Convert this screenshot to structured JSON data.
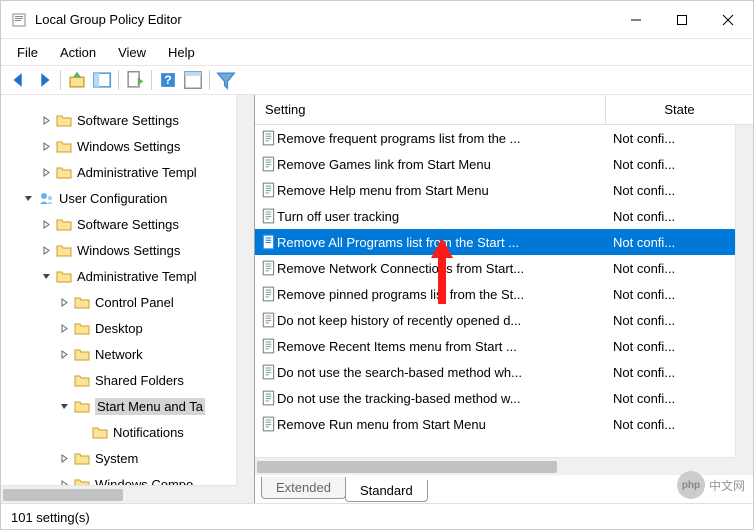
{
  "window": {
    "title": "Local Group Policy Editor"
  },
  "menu": {
    "file": "File",
    "action": "Action",
    "view": "View",
    "help": "Help"
  },
  "tree": {
    "items": [
      {
        "level": 2,
        "expand": "closed",
        "icon": "folder",
        "label": "Software Settings",
        "sel": false
      },
      {
        "level": 2,
        "expand": "closed",
        "icon": "folder",
        "label": "Windows Settings",
        "sel": false
      },
      {
        "level": 2,
        "expand": "closed",
        "icon": "folder",
        "label": "Administrative Templ",
        "sel": false
      },
      {
        "level": 1,
        "expand": "open",
        "icon": "user",
        "label": "User Configuration",
        "sel": false
      },
      {
        "level": 2,
        "expand": "closed",
        "icon": "folder",
        "label": "Software Settings",
        "sel": false
      },
      {
        "level": 2,
        "expand": "closed",
        "icon": "folder",
        "label": "Windows Settings",
        "sel": false
      },
      {
        "level": 2,
        "expand": "open",
        "icon": "folder",
        "label": "Administrative Templ",
        "sel": false
      },
      {
        "level": 3,
        "expand": "closed",
        "icon": "folder",
        "label": "Control Panel",
        "sel": false
      },
      {
        "level": 3,
        "expand": "closed",
        "icon": "folder",
        "label": "Desktop",
        "sel": false
      },
      {
        "level": 3,
        "expand": "closed",
        "icon": "folder",
        "label": "Network",
        "sel": false
      },
      {
        "level": 3,
        "expand": "none",
        "icon": "folder",
        "label": "Shared Folders",
        "sel": false
      },
      {
        "level": 3,
        "expand": "open",
        "icon": "folder",
        "label": "Start Menu and Ta",
        "sel": true
      },
      {
        "level": 4,
        "expand": "none",
        "icon": "folder",
        "label": "Notifications",
        "sel": false
      },
      {
        "level": 3,
        "expand": "closed",
        "icon": "folder",
        "label": "System",
        "sel": false
      },
      {
        "level": 3,
        "expand": "closed",
        "icon": "folder",
        "label": "Windows Compo",
        "sel": false
      }
    ]
  },
  "grid": {
    "header": {
      "setting": "Setting",
      "state": "State"
    },
    "rows": [
      {
        "setting": "Remove frequent programs list from the ...",
        "state": "Not confi...",
        "sel": false
      },
      {
        "setting": "Remove Games link from Start Menu",
        "state": "Not confi...",
        "sel": false
      },
      {
        "setting": "Remove Help menu from Start Menu",
        "state": "Not confi...",
        "sel": false
      },
      {
        "setting": "Turn off user tracking",
        "state": "Not confi...",
        "sel": false
      },
      {
        "setting": "Remove All Programs list from the Start ...",
        "state": "Not confi...",
        "sel": true
      },
      {
        "setting": "Remove Network Connections from Start...",
        "state": "Not confi...",
        "sel": false
      },
      {
        "setting": "Remove pinned programs list from the St...",
        "state": "Not confi...",
        "sel": false
      },
      {
        "setting": "Do not keep history of recently opened d...",
        "state": "Not confi...",
        "sel": false
      },
      {
        "setting": "Remove Recent Items menu from Start ...",
        "state": "Not confi...",
        "sel": false
      },
      {
        "setting": "Do not use the search-based method wh...",
        "state": "Not confi...",
        "sel": false
      },
      {
        "setting": "Do not use the tracking-based method w...",
        "state": "Not confi...",
        "sel": false
      },
      {
        "setting": "Remove Run menu from Start Menu",
        "state": "Not confi...",
        "sel": false
      }
    ]
  },
  "tabs": {
    "extended": "Extended",
    "standard": "Standard"
  },
  "status": {
    "text": "101 setting(s)"
  },
  "watermark": {
    "brand": "php",
    "text": "中文网"
  }
}
